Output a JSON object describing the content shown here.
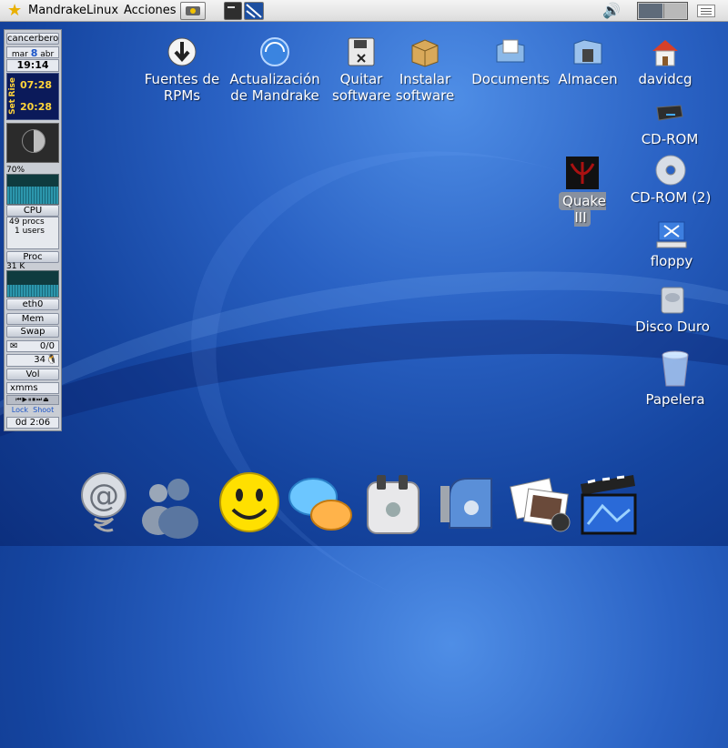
{
  "panel": {
    "distro_label": "MandrakeLinux",
    "menu_actions": "Acciones",
    "icons": [
      "star-icon",
      "run-dialog-icon",
      "terminal-icon",
      "kde-control-icon",
      "speaker-icon",
      "workspace-pager",
      "window-list-icon"
    ]
  },
  "gkrellm": {
    "host": "cancerbero",
    "date_day": "mar",
    "date_num": "8",
    "date_month": "abr",
    "time": "19:14",
    "sunrise": "07:28",
    "sunset": "20:28",
    "rise_label": "Rise",
    "set_label": "Set",
    "cpu_percent": "70%",
    "cpu_label": "CPU",
    "procs": "49 procs",
    "users": "1 users",
    "proc_label": "Proc",
    "net_rate": "31 K",
    "net_label": "eth0",
    "mem_label": "Mem",
    "swap_label": "Swap",
    "mail_count": "0/0",
    "temp_value": "34",
    "vol_label": "Vol",
    "player": "xmms",
    "lock_label": "Lock",
    "shoot_label": "Shoot",
    "uptime": "0d 2:06"
  },
  "desktop_icons": {
    "rpms": "Fuentes de RPMs",
    "update": "Actualización de Mandrake",
    "remove": "Quitar software",
    "install": "Instalar software",
    "documents": "Documents",
    "store": "Almacen",
    "home": "davidcg",
    "cdrom": "CD-ROM",
    "quake": "Quake III",
    "cdrom2": "CD-ROM (2)",
    "floppy": "floppy",
    "harddisk": "Disco Duro",
    "trash": "Papelera"
  },
  "dock": [
    "mail-icon",
    "messenger-icon",
    "smiley-icon",
    "chat-icon",
    "toaster-icon",
    "mailbox-icon",
    "photos-icon",
    "movie-icon"
  ],
  "colors": {
    "desktop_blue": "#2a62c4",
    "panel_grey": "#dcdcdc",
    "gkrellm_clock": "#ffd43a"
  }
}
